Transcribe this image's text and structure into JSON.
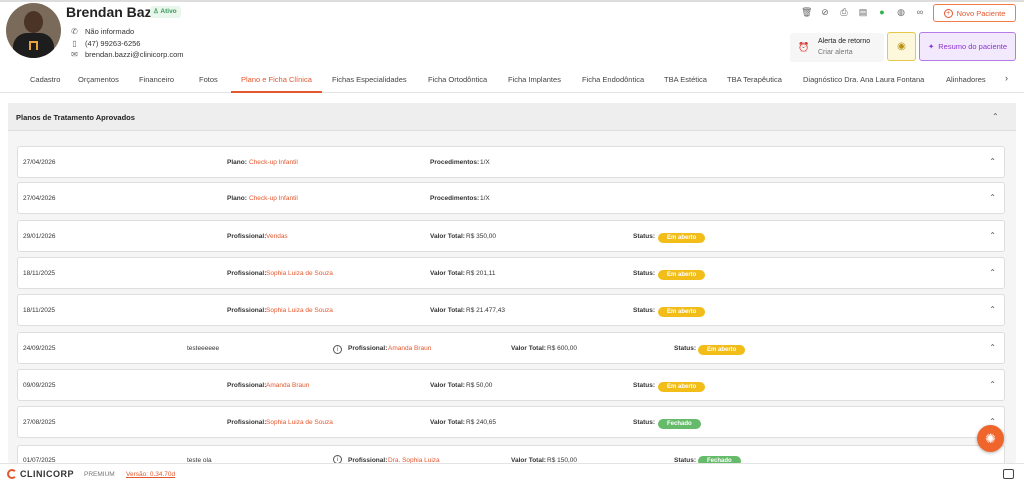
{
  "patient": {
    "name": "Brendan Bazzi",
    "status": "Ativo",
    "address": "Não informado",
    "phone": "(47) 99263-6256",
    "email": "brendan.bazzi@clinicorp.com"
  },
  "toolbar": {
    "new_patient_label": "Novo Paciente",
    "alert_title": "Alerta de retorno",
    "alert_action": "Criar alerta",
    "summary_label": "Resumo do paciente"
  },
  "tabs": [
    "Cadastro",
    "Orçamentos",
    "Financeiro",
    "Fotos",
    "Plano e Ficha Clínica",
    "Fichas Especialidades",
    "Ficha Ortodôntica",
    "Ficha Implantes",
    "Ficha Endodôntica",
    "TBA Estética",
    "TBA Terapêutica",
    "Diagnóstico Dra. Ana Laura Fontana",
    "Alinhadores"
  ],
  "active_tab": "Plano e Ficha Clínica",
  "section": {
    "title": "Planos de Tratamento Aprovados"
  },
  "labels": {
    "plano": "Plano:",
    "procedimentos": "Procedimentos:",
    "profissional": "Profissional:",
    "valor_total": "Valor Total:",
    "status": "Status:"
  },
  "plans": [
    {
      "date": "27/04/2026",
      "plano": "Check-up Infantil",
      "procedimentos": "1/X"
    },
    {
      "date": "27/04/2026",
      "plano": "Check-up Infantil",
      "procedimentos": "1/X"
    },
    {
      "date": "29/01/2026",
      "profissional": "Vendas",
      "valor": "R$ 350,00",
      "status": "Em aberto"
    },
    {
      "date": "18/11/2025",
      "profissional": "Sophia Luiza de Souza",
      "valor": "R$ 201,11",
      "status": "Em aberto"
    },
    {
      "date": "18/11/2025",
      "profissional": "Sophia Luiza de Souza",
      "valor": "R$ 21.477,43",
      "status": "Em aberto"
    },
    {
      "date": "24/09/2025",
      "desc": "testeeeeee",
      "profissional": "Amanda Braun",
      "valor": "R$ 600,00",
      "status": "Em aberto"
    },
    {
      "date": "09/09/2025",
      "profissional": "Amanda Braun",
      "valor": "R$ 50,00",
      "status": "Em aberto"
    },
    {
      "date": "27/08/2025",
      "profissional": "Sophia Luiza de Souza",
      "valor": "R$ 240,65",
      "status": "Fechado"
    },
    {
      "date": "01/07/2025",
      "desc": "teste ola",
      "profissional": "Dra. Sophia Luiza",
      "valor": "R$ 150,00",
      "status": "Fechado"
    }
  ],
  "footer": {
    "brand": "CLINICORP",
    "tier": "PREMIUM",
    "version": "Versão: 0.34.70d"
  },
  "colors": {
    "accent": "#e4572e",
    "open_status": "#f2bd18",
    "closed_status": "#66bb6a",
    "summary_purple": "#8b34d1"
  }
}
